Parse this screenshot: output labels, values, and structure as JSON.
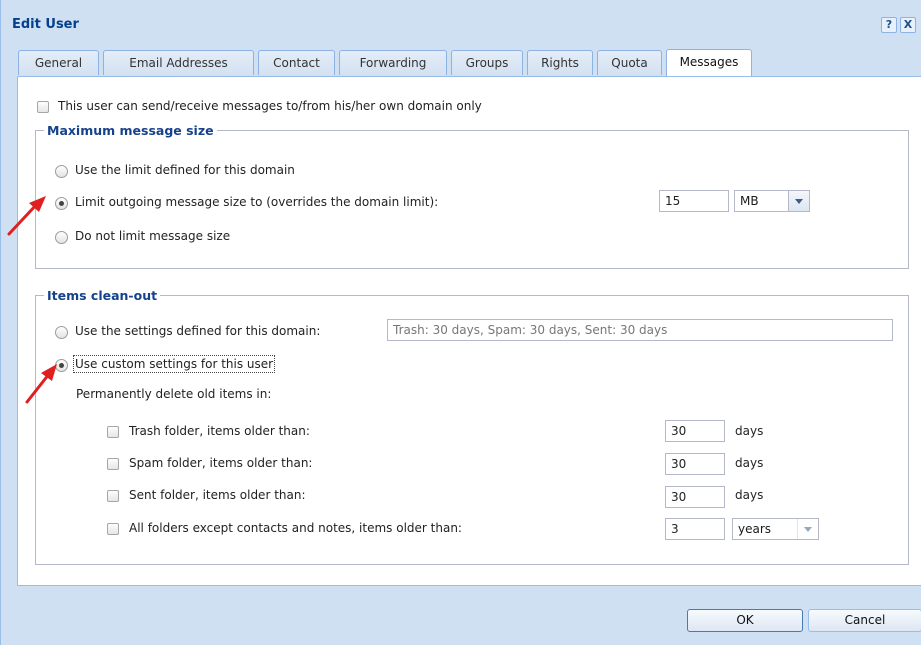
{
  "window": {
    "title": "Edit User",
    "help_glyph": "?",
    "close_glyph": "X"
  },
  "tabs": [
    {
      "label": "General"
    },
    {
      "label": "Email Addresses"
    },
    {
      "label": "Contact"
    },
    {
      "label": "Forwarding"
    },
    {
      "label": "Groups"
    },
    {
      "label": "Rights"
    },
    {
      "label": "Quota"
    },
    {
      "label": "Messages",
      "active": true
    }
  ],
  "own_domain": {
    "label": "This user can send/receive messages to/from his/her own domain only",
    "checked": false
  },
  "max_size": {
    "legend": "Maximum message size",
    "options": [
      {
        "label": "Use the limit defined for this domain",
        "selected": false
      },
      {
        "label": "Limit outgoing message size to (overrides the domain limit):",
        "selected": true
      },
      {
        "label": "Do not limit message size",
        "selected": false
      }
    ],
    "limit_value": "15",
    "unit": "MB"
  },
  "cleanout": {
    "legend": "Items clean-out",
    "options": [
      {
        "label": "Use the settings defined for this domain:",
        "selected": false
      },
      {
        "label": "Use custom settings for this user",
        "selected": true
      }
    ],
    "domain_settings": "Trash: 30 days, Spam: 30 days, Sent: 30 days",
    "delete_label": "Permanently delete old items in:",
    "rows": [
      {
        "label": "Trash folder, items older than:",
        "value": "30",
        "unit": "days"
      },
      {
        "label": "Spam folder, items older than:",
        "value": "30",
        "unit": "days"
      },
      {
        "label": "Sent folder, items older than:",
        "value": "30",
        "unit": "days"
      },
      {
        "label": "All folders except contacts and notes, items older than:",
        "value": "3",
        "unit": "years"
      }
    ]
  },
  "buttons": {
    "ok": "OK",
    "cancel": "Cancel"
  },
  "colors": {
    "accent": "#15428b",
    "annotation_arrow": "#e02020"
  }
}
